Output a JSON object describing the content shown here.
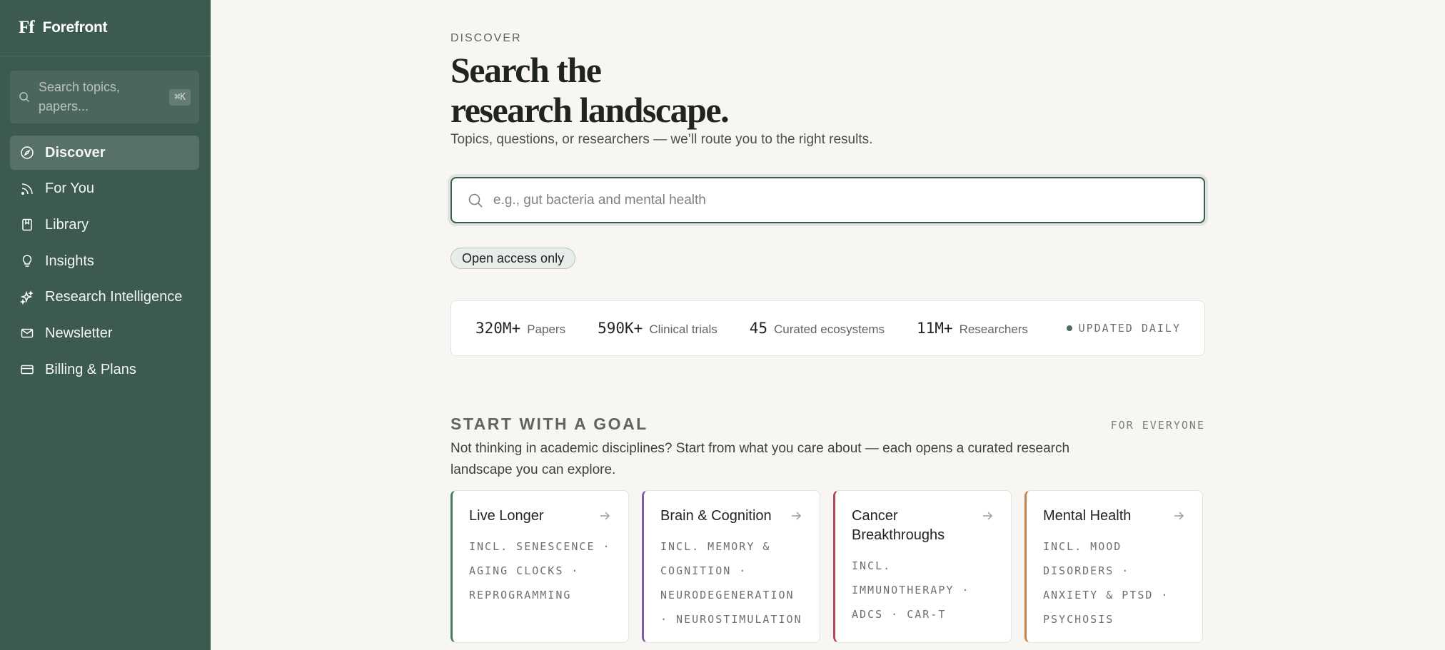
{
  "sidebar": {
    "brand_logo": "Ff",
    "brand_name": "Forefront",
    "search_placeholder": "Search topics, papers...",
    "search_shortcut": "⌘K",
    "items": [
      {
        "label": "Discover",
        "icon": "compass-icon",
        "active": true
      },
      {
        "label": "For You",
        "icon": "rss-icon"
      },
      {
        "label": "Library",
        "icon": "bookmark-book-icon"
      },
      {
        "label": "Insights",
        "icon": "lightbulb-icon"
      },
      {
        "label": "Research Intelligence",
        "icon": "sparkles-icon"
      },
      {
        "label": "Newsletter",
        "icon": "mail-icon"
      },
      {
        "label": "Billing & Plans",
        "icon": "credit-card-icon"
      }
    ]
  },
  "hero": {
    "eyebrow": "DISCOVER",
    "title_line1": "Search the",
    "title_line2": "research landscape.",
    "subtitle": "Topics, questions, or researchers — we’ll route you to the right results.",
    "search_placeholder": "e.g., gut bacteria and mental health",
    "filter_chip": "Open access only"
  },
  "stats": {
    "items": [
      {
        "num": "320M+",
        "label": "Papers"
      },
      {
        "num": "590K+",
        "label": "Clinical trials"
      },
      {
        "num": "45",
        "label": "Curated ecosystems"
      },
      {
        "num": "11M+",
        "label": "Researchers"
      }
    ],
    "updated": "UPDATED DAILY"
  },
  "goals": {
    "heading": "START WITH A GOAL",
    "tag": "FOR EVERYONE",
    "description": "Not thinking in academic disciplines? Start from what you care about — each opens a curated research landscape you can explore.",
    "cards": [
      {
        "title": "Live Longer",
        "tags": "INCL. SENESCENCE · AGING CLOCKS · REPROGRAMMING",
        "accent": "#4c7a5e"
      },
      {
        "title": "Brain & Cognition",
        "tags": "INCL. MEMORY & COGNITION · NEURODEGENERATION · NEUROSTIMULATION",
        "accent": "#7b5ea7"
      },
      {
        "title": "Cancer Breakthroughs",
        "tags": "INCL. IMMUNOTHERAPY · ADCS · CAR-T",
        "accent": "#b5475a"
      },
      {
        "title": "Mental Health",
        "tags": "INCL. MOOD DISORDERS · ANXIETY & PTSD · PSYCHOSIS",
        "accent": "#c9824a"
      }
    ]
  },
  "colors": {
    "sidebar_bg": "#3c5a4f",
    "page_bg": "#f7f6f2",
    "accent": "#3c5a4f"
  }
}
